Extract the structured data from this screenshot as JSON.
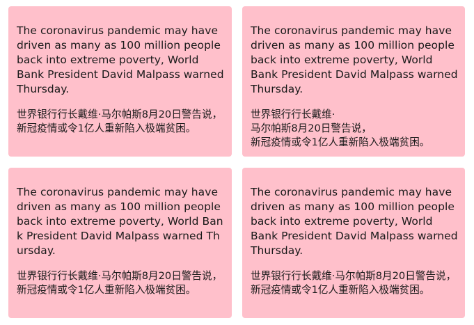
{
  "cards": [
    {
      "en": "The coronavirus pandemic may have driven as many as 100 million people back into extreme poverty, World Bank President David Malpass warned Thursday.",
      "zh": "世界银行行长戴维·马尔帕斯8月20日警告说，新冠疫情或令1亿人重新陷入极端贫困。"
    },
    {
      "en": "The coronavirus pandemic may have driven as many as 100 million people back into extreme poverty, World Bank President David Malpass warned Thursday.",
      "zh_lines": [
        "世界银行行长戴维·",
        "马尔帕斯8月20日警告说，",
        "新冠疫情或令1亿人重新陷入极端贫困。"
      ]
    },
    {
      "en": "The coronavirus pandemic may have driven as many as 100 million people back into extreme poverty, World Bank President David Malpass warned Thursday.",
      "zh": "世界银行行长戴维·马尔帕斯8月20日警告说，新冠疫情或令1亿人重新陷入极端贫困。"
    },
    {
      "en": "The coronavirus pandemic may have driven as many as 100 million people back into extreme poverty, World Bank President David Malpass warned Thursday.",
      "zh": "世界银行行长戴维·马尔帕斯8月20日警告说，新冠疫情或令1亿人重新陷入极端贫困。"
    }
  ]
}
